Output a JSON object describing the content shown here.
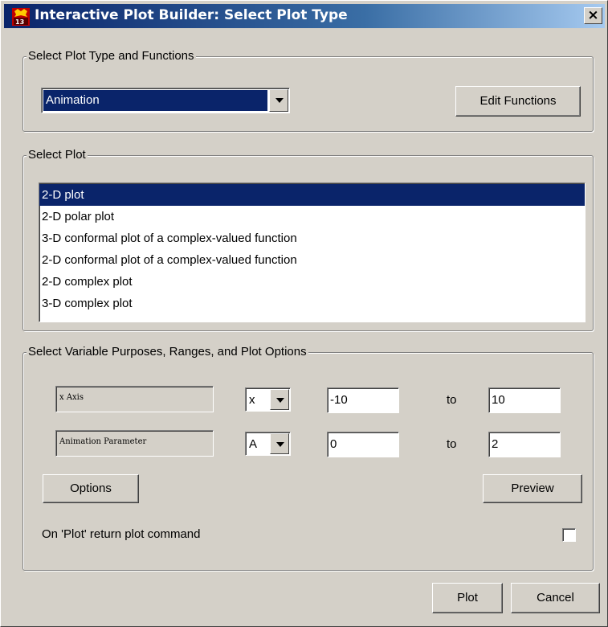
{
  "window": {
    "title": "Interactive Plot Builder: Select Plot Type",
    "close_label": "×"
  },
  "plot_type_group": {
    "legend": "Select Plot Type and Functions",
    "selected_type": "Animation",
    "edit_functions_label": "Edit Functions"
  },
  "select_plot_group": {
    "legend": "Select Plot",
    "items": [
      "2-D plot",
      "2-D polar plot",
      "3-D conformal plot of a complex-valued function",
      "2-D conformal plot of a complex-valued function",
      "2-D complex plot",
      "3-D complex plot"
    ],
    "selected_index": 0
  },
  "variables_group": {
    "legend": "Select Variable Purposes, Ranges, and Plot Options",
    "rows": [
      {
        "purpose": "x Axis",
        "variable": "x",
        "from": "-10",
        "to_label": "to",
        "to": "10"
      },
      {
        "purpose": "Animation Parameter",
        "variable": "A",
        "from": "0",
        "to_label": "to",
        "to": "2"
      }
    ],
    "options_label": "Options",
    "preview_label": "Preview",
    "return_command_label": "On 'Plot' return plot command",
    "return_command_checked": false
  },
  "footer": {
    "plot_label": "Plot",
    "cancel_label": "Cancel"
  },
  "colors": {
    "dialog_bg": "#d4d0c8",
    "title_gradient_start": "#0a246a",
    "selection": "#0a246a"
  }
}
